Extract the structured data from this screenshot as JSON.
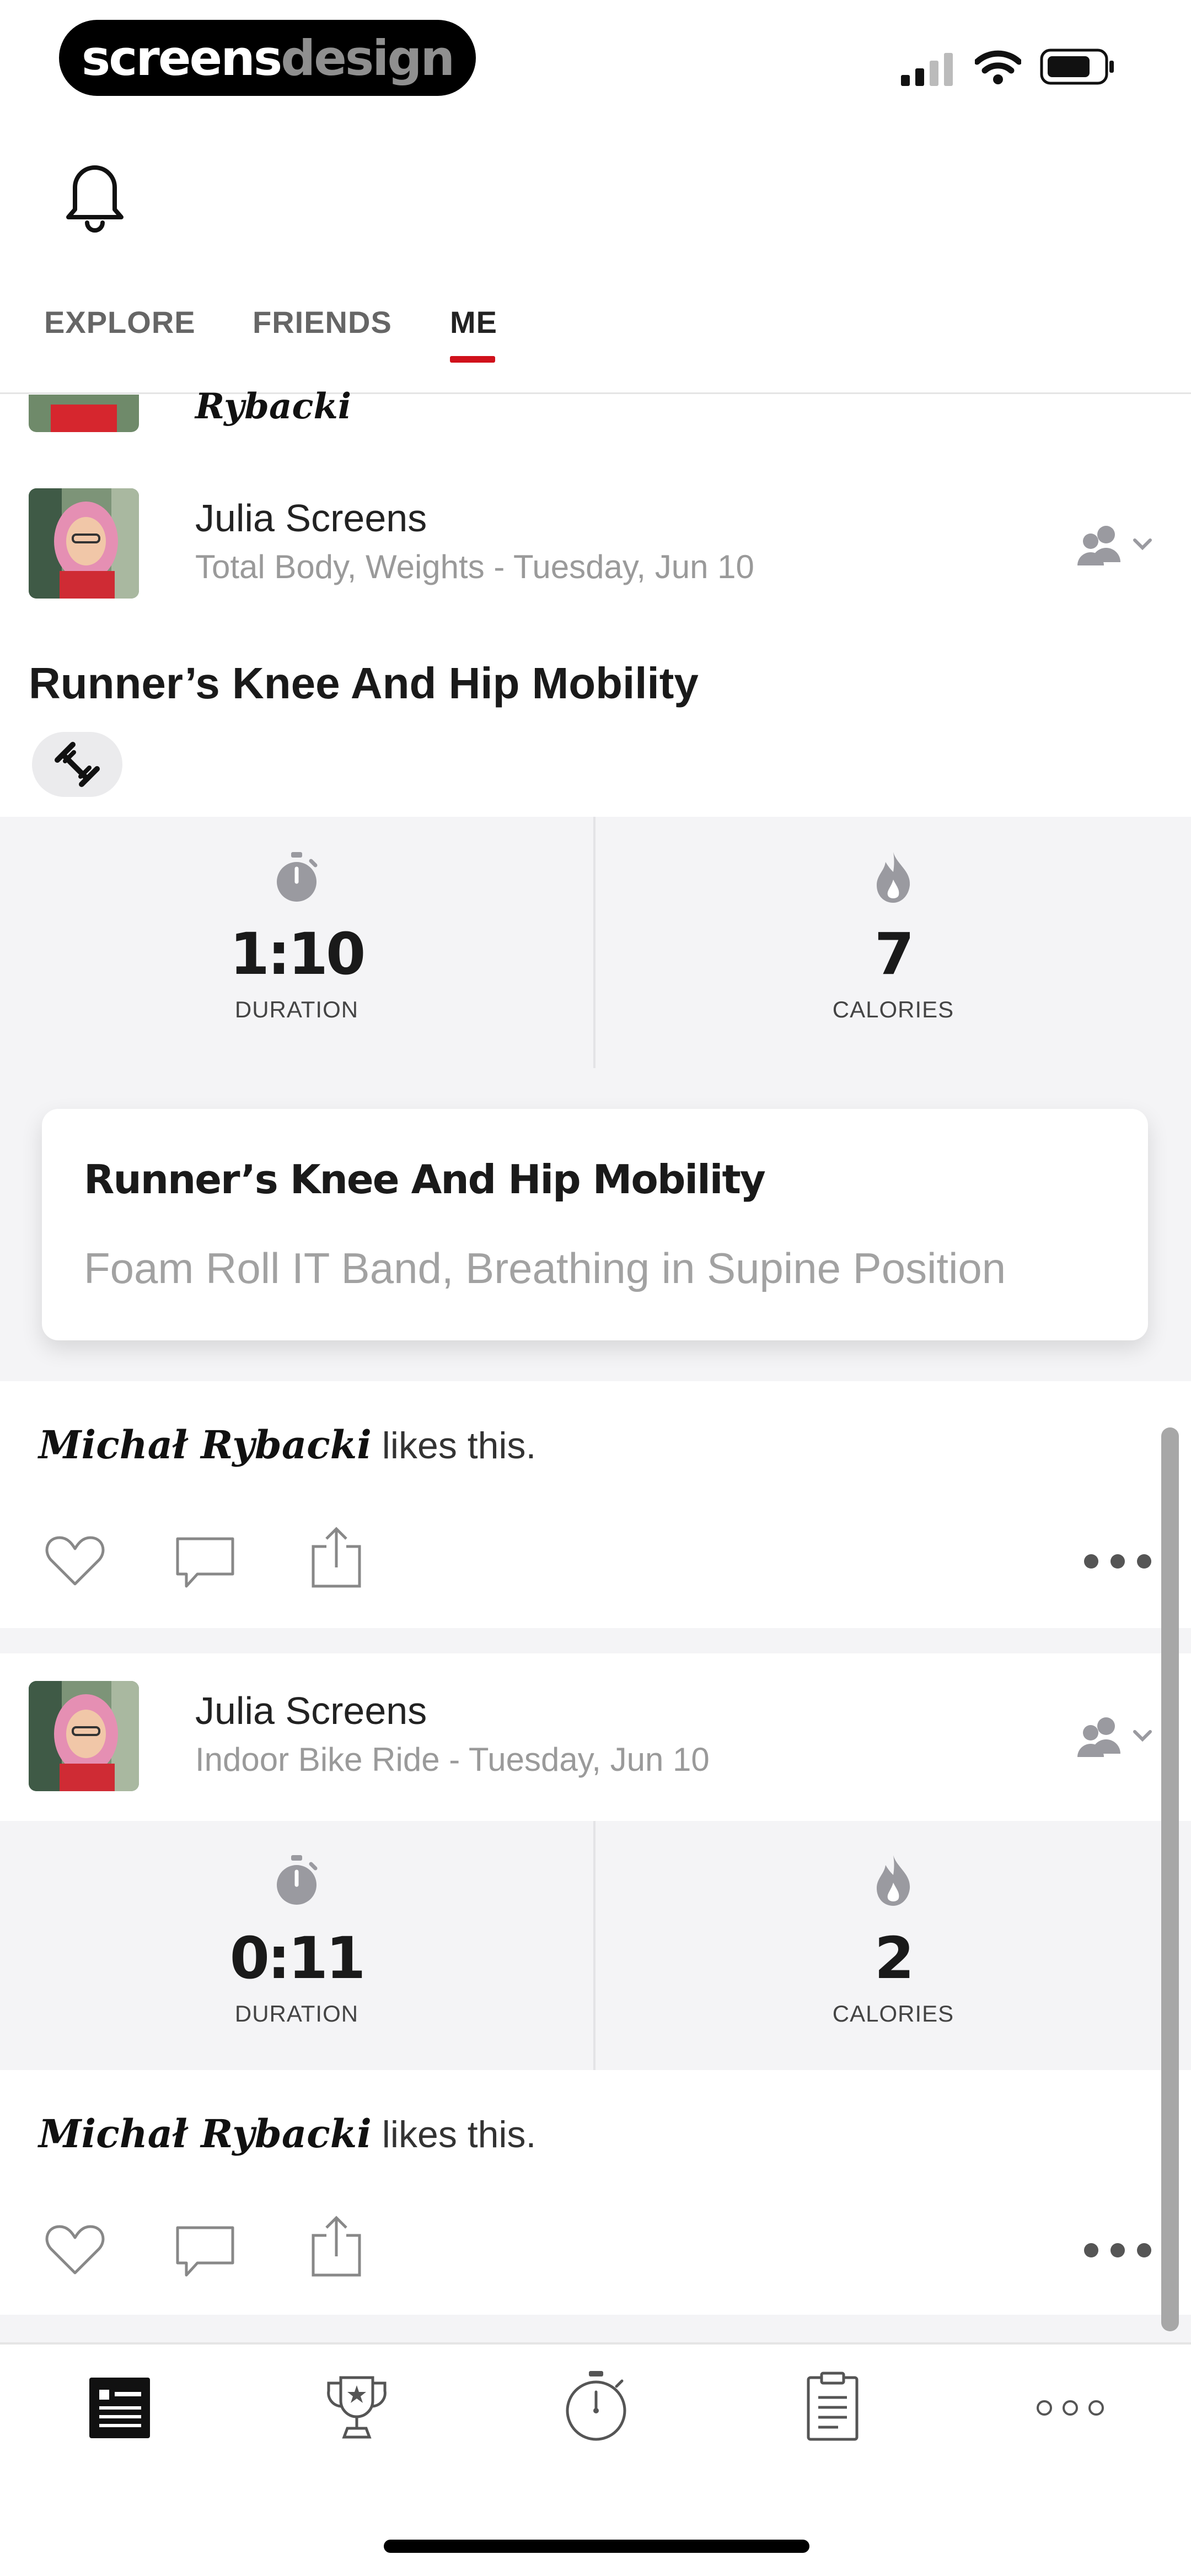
{
  "status_bar": {
    "brand_part1": "screens",
    "brand_part2": "design"
  },
  "header": {
    "notifications_icon": "bell-icon"
  },
  "tabs": [
    {
      "label": "EXPLORE",
      "active": false
    },
    {
      "label": "FRIENDS",
      "active": false
    },
    {
      "label": "ME",
      "active": true
    }
  ],
  "feed": {
    "partial_item_name": "Rybacki",
    "posts": [
      {
        "user": "Julia Screens",
        "meta": "Total Body, Weights - Tuesday, Jun 10",
        "title": "Runner’s Knee And Hip Mobility",
        "tag_icon": "dumbbell-icon",
        "stats": [
          {
            "value": "1:10",
            "label": "DURATION",
            "icon": "stopwatch-icon"
          },
          {
            "value": "7",
            "label": "CALORIES",
            "icon": "flame-icon"
          }
        ],
        "workout_card": {
          "title": "Runner’s Knee And Hip Mobility",
          "exercises": "Foam Roll IT Band, Breathing in Supine Position"
        },
        "liker": "Michał Rybacki",
        "likes_suffix": " likes this."
      },
      {
        "user": "Julia Screens",
        "meta": "Indoor Bike Ride - Tuesday, Jun 10",
        "stats": [
          {
            "value": "0:11",
            "label": "DURATION",
            "icon": "stopwatch-icon"
          },
          {
            "value": "2",
            "label": "CALORIES",
            "icon": "flame-icon"
          }
        ],
        "liker": "Michał Rybacki",
        "likes_suffix": " likes this."
      }
    ]
  },
  "bottom_nav": [
    {
      "name": "feed",
      "icon": "feed-icon",
      "active": true
    },
    {
      "name": "challenges",
      "icon": "trophy-icon",
      "active": false
    },
    {
      "name": "record",
      "icon": "stopwatch-icon",
      "active": false
    },
    {
      "name": "plans",
      "icon": "clipboard-icon",
      "active": false
    },
    {
      "name": "more",
      "icon": "more-icon",
      "active": false
    }
  ],
  "colors": {
    "accent": "#d0111b",
    "panel": "#f4f4f6",
    "icon_gray": "#9a9aa0"
  }
}
